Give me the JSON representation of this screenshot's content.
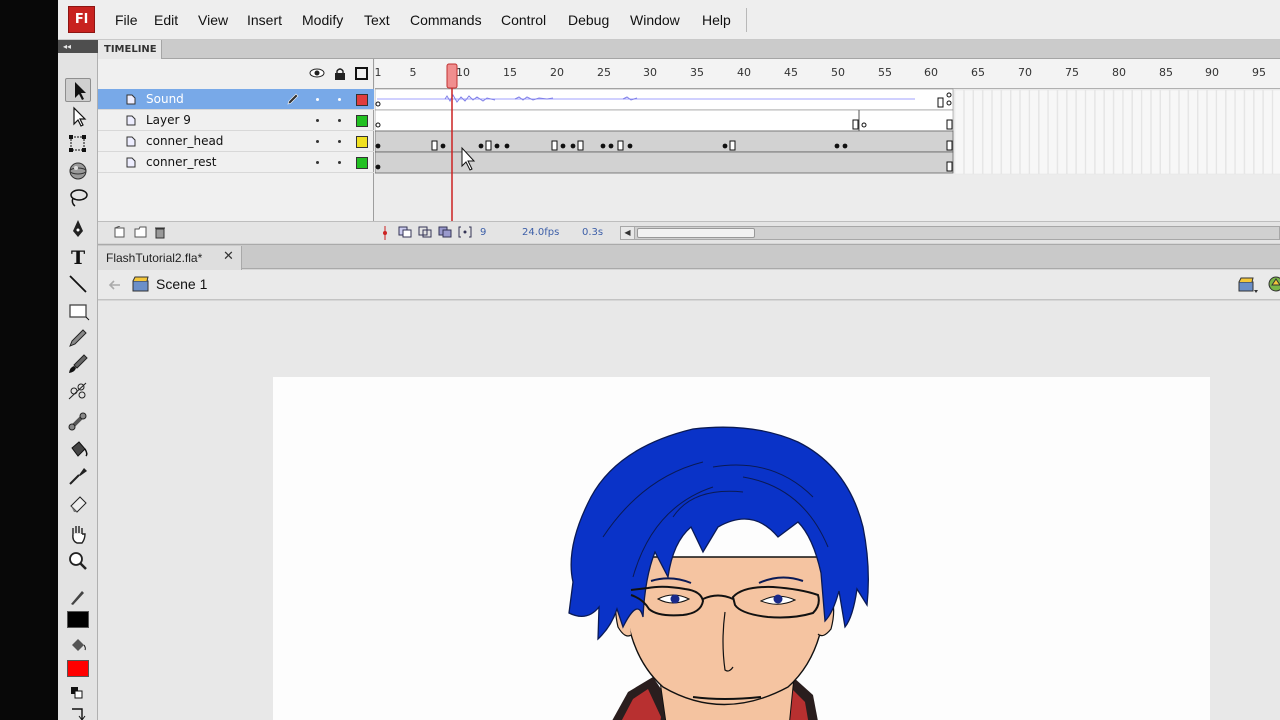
{
  "app": {
    "logo_text": "Fl",
    "menu": [
      "File",
      "Edit",
      "View",
      "Insert",
      "Modify",
      "Text",
      "Commands",
      "Control",
      "Debug",
      "Window",
      "Help"
    ]
  },
  "tools": {
    "items": [
      "selection-tool",
      "subselection-tool",
      "free-transform-tool",
      "3d-rotation-tool",
      "lasso-tool",
      "pen-tool",
      "text-tool",
      "line-tool",
      "rectangle-tool",
      "pencil-tool",
      "brush-tool",
      "deco-tool",
      "bone-tool",
      "paint-bucket-tool",
      "eyedropper-tool",
      "eraser-tool",
      "hand-tool",
      "zoom-tool"
    ],
    "stroke_color": "#000000",
    "fill_color": "#ff0000"
  },
  "timeline": {
    "tab_label": "TIMELINE",
    "ruler_labels": [
      "1",
      "5",
      "10",
      "15",
      "20",
      "25",
      "30",
      "35",
      "40",
      "45",
      "50",
      "55",
      "60",
      "65",
      "70",
      "75",
      "80",
      "85",
      "90",
      "95"
    ],
    "current_frame": 9,
    "layers": [
      {
        "name": "Sound",
        "outline_color": "#e03c3c",
        "selected": true
      },
      {
        "name": "Layer 9",
        "outline_color": "#22c022",
        "selected": false
      },
      {
        "name": "conner_head",
        "outline_color": "#f0e020",
        "selected": false
      },
      {
        "name": "conner_rest",
        "outline_color": "#22c022",
        "selected": false
      }
    ],
    "status": {
      "frame": "9",
      "fps": "24.0fps",
      "time": "0.3s"
    }
  },
  "document": {
    "tab_label": "FlashTutorial2.fla*",
    "scene_label": "Scene 1"
  }
}
